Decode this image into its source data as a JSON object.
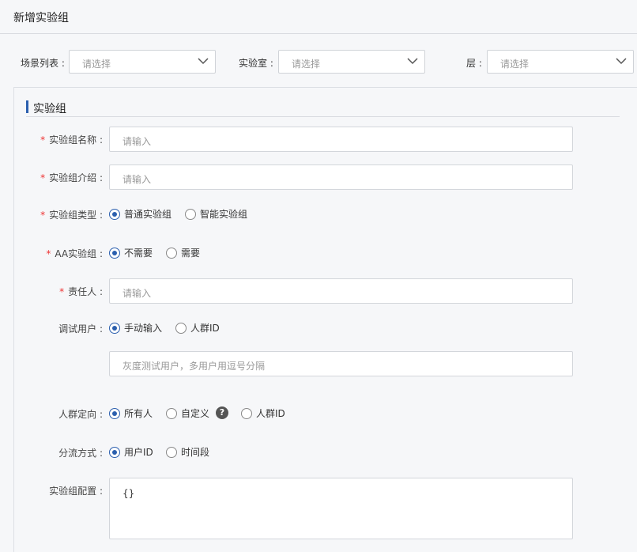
{
  "page": {
    "title": "新增实验组"
  },
  "filters": {
    "scene": {
      "label": "场景列表 :",
      "placeholder": "请选择"
    },
    "lab": {
      "label": "实验室 :",
      "placeholder": "请选择"
    },
    "layer": {
      "label": "层 :",
      "placeholder": "请选择"
    }
  },
  "section": {
    "title": "实验组"
  },
  "required_mark": "*",
  "form": {
    "name": {
      "label": "实验组名称 :",
      "placeholder": "请输入"
    },
    "intro": {
      "label": "实验组介绍 :",
      "placeholder": "请输入"
    },
    "type": {
      "label": "实验组类型 :",
      "options": [
        "普通实验组",
        "智能实验组"
      ],
      "selected": 0
    },
    "aa": {
      "label": "AA实验组 :",
      "options": [
        "不需要",
        "需要"
      ],
      "selected": 0
    },
    "owner": {
      "label": "责任人 :",
      "placeholder": "请输入"
    },
    "debug_user": {
      "label": "调试用户 :",
      "options": [
        "手动输入",
        "人群ID"
      ],
      "selected": 0,
      "placeholder": "灰度测试用户，多用户用逗号分隔"
    },
    "targeting": {
      "label": "人群定向 :",
      "options": [
        "所有人",
        "自定义",
        "人群ID"
      ],
      "selected": 0,
      "help_icon": "?"
    },
    "split": {
      "label": "分流方式 :",
      "options": [
        "用户ID",
        "时间段"
      ],
      "selected": 0
    },
    "config": {
      "label": "实验组配置 :",
      "value": "{}"
    }
  },
  "colors": {
    "accent": "#2b5fae",
    "required": "#ee3333"
  }
}
